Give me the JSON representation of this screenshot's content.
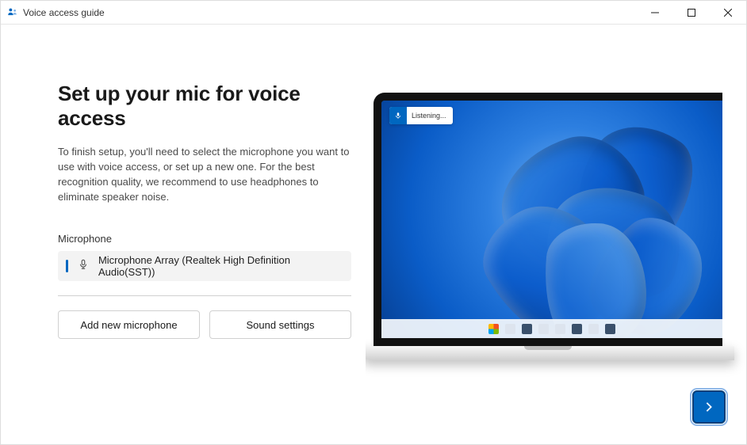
{
  "titlebar": {
    "title": "Voice access guide"
  },
  "main": {
    "heading": "Set up your mic for voice access",
    "description": "To finish setup, you'll need to select the microphone you want to use with voice access, or set up a new one. For the best recognition quality, we recommend to use headphones to eliminate speaker noise.",
    "mic_label": "Microphone",
    "mic_selected": "Microphone Array (Realtek High Definition Audio(SST))",
    "add_mic_label": "Add new microphone",
    "sound_settings_label": "Sound settings"
  },
  "preview": {
    "listening_label": "Listening..."
  },
  "nav": {
    "next_label": "Next"
  }
}
